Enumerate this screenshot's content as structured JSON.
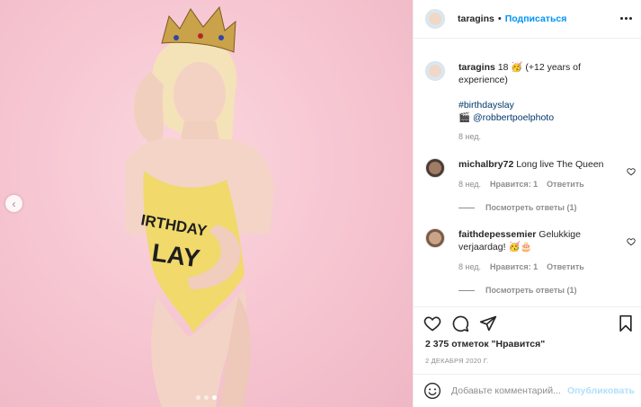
{
  "post": {
    "username": "taragins",
    "follow_label": "Подписаться",
    "header_separator": "•"
  },
  "caption": {
    "username": "taragins",
    "text": "18 🥳 (+12 years of experience)",
    "hashtag": "#birthdayslay",
    "credit_prefix": "🎬",
    "credit": "@robbertpoelphoto",
    "time": "8 нед."
  },
  "comments": [
    {
      "username": "michalbry72",
      "text": "Long live The Queen",
      "time": "8 нед.",
      "likes": "Нравится: 1",
      "reply": "Ответить",
      "view_replies": "Посмотреть ответы (1)"
    },
    {
      "username": "faithdepessemier",
      "text": "Gelukkige verjaardag! 🥳🎂",
      "time": "8 нед.",
      "likes": "Нравится: 1",
      "reply": "Ответить",
      "view_replies": "Посмотреть ответы (1)"
    }
  ],
  "engagement": {
    "likes": "2 375 отметок \"Нравится\"",
    "date": "2 ДЕКАБРЯ 2020 Г."
  },
  "composer": {
    "placeholder": "Добавьте комментарий...",
    "publish_label": "Опубликовать"
  },
  "photo_overlay": {
    "suit_text_line1": "IRTHDAY",
    "suit_text_line2": "LAY"
  },
  "carousel": {
    "total": 3,
    "active_index": 2
  },
  "icons": {
    "heart": "heart-icon",
    "comment": "comment-icon",
    "share": "share-icon",
    "save": "bookmark-icon",
    "emoji": "emoji-icon",
    "more": "more-icon",
    "prev": "chevron-left-icon"
  },
  "colors": {
    "accent": "#0095f6",
    "photo_bg": "#f5c3cf",
    "swimsuit": "#f1d96b"
  }
}
